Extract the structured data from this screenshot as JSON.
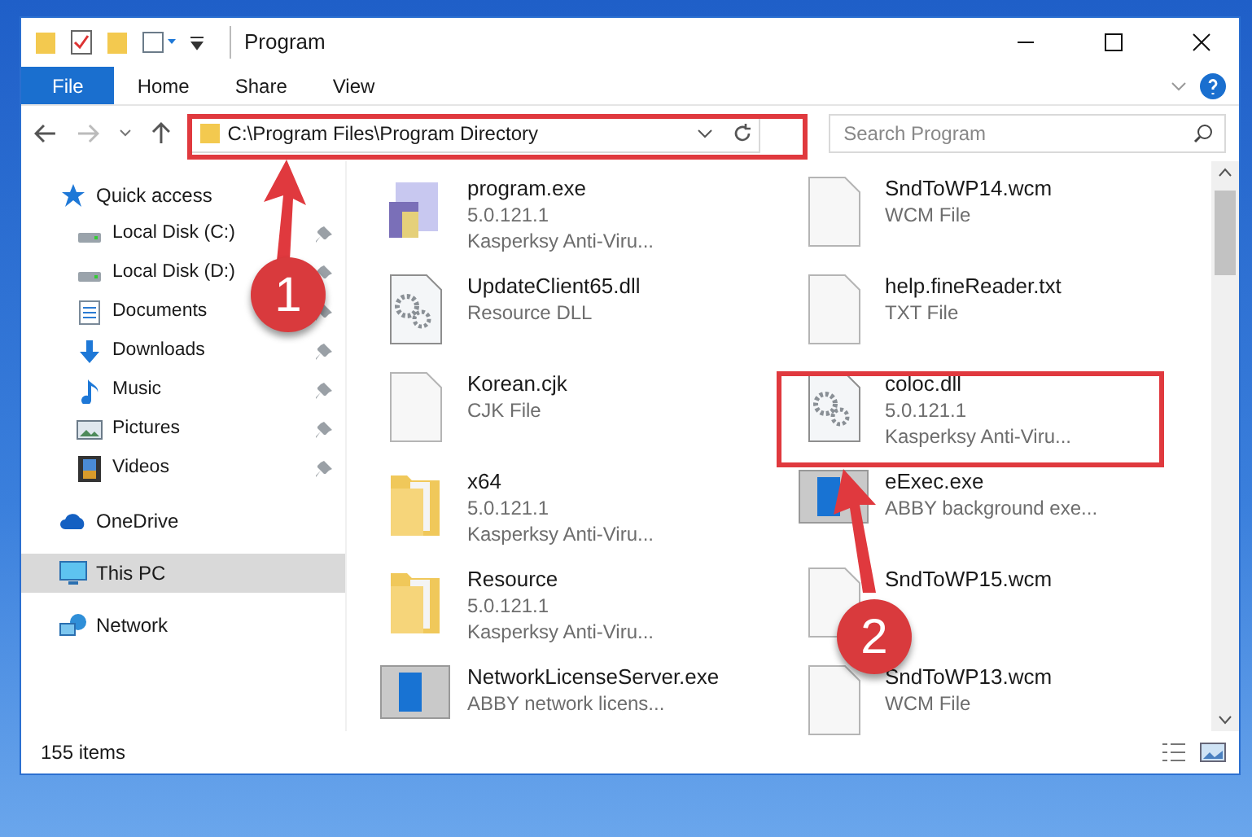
{
  "window": {
    "title": "Program"
  },
  "ribbon_tabs": [
    {
      "label": "File",
      "kind": "file"
    },
    {
      "label": "Home",
      "kind": "tab"
    },
    {
      "label": "Share",
      "kind": "tab"
    },
    {
      "label": "View",
      "kind": "tab"
    }
  ],
  "address": {
    "path": "C:\\Program Files\\Program Directory"
  },
  "search": {
    "placeholder": "Search Program"
  },
  "sidebar": {
    "items": [
      {
        "label": "Quick access",
        "selected": false,
        "children": [
          {
            "label": "Local Disk (C:)",
            "pinned": true,
            "selected": false
          },
          {
            "label": "Local Disk (D:)",
            "pinned": true,
            "selected": false
          },
          {
            "label": "Documents",
            "pinned": true,
            "selected": false
          },
          {
            "label": "Downloads",
            "pinned": true,
            "selected": false
          },
          {
            "label": "Music",
            "pinned": true,
            "selected": false
          },
          {
            "label": "Pictures",
            "pinned": true,
            "selected": false
          },
          {
            "label": "Videos",
            "pinned": true,
            "selected": false
          }
        ]
      },
      {
        "label": "OneDrive",
        "selected": false
      },
      {
        "label": "This PC",
        "selected": true
      },
      {
        "label": "Network",
        "selected": false
      }
    ]
  },
  "files": [
    {
      "name": "program.exe",
      "details": [
        "5.0.121.1",
        "Kasperksy Anti-Viru..."
      ],
      "kind": "installer"
    },
    {
      "name": "SndToWP14.wcm",
      "details": [
        "WCM File"
      ],
      "kind": "blank"
    },
    {
      "name": "UpdateClient65.dll",
      "details": [
        "Resource DLL"
      ],
      "kind": "gear"
    },
    {
      "name": "help.fineReader.txt",
      "details": [
        "TXT File"
      ],
      "kind": "blank"
    },
    {
      "name": "Korean.cjk",
      "details": [
        "CJK File"
      ],
      "kind": "blank"
    },
    {
      "name": "coloc.dll",
      "details": [
        "5.0.121.1",
        "Kasperksy Anti-Viru..."
      ],
      "kind": "gear"
    },
    {
      "name": "x64",
      "details": [
        "5.0.121.1",
        "Kasperksy Anti-Viru..."
      ],
      "kind": "folder"
    },
    {
      "name": "eExec.exe",
      "details": [
        "ABBY background exe..."
      ],
      "kind": "window"
    },
    {
      "name": "Resource",
      "details": [
        "5.0.121.1",
        "Kasperksy Anti-Viru..."
      ],
      "kind": "folder"
    },
    {
      "name": "SndToWP15.wcm",
      "kind": "blank"
    },
    {
      "name": "NetworkLicenseServer.exe",
      "details": [
        "ABBY network licens..."
      ],
      "kind": "window"
    },
    {
      "name": "SndToWP13.wcm",
      "details": [
        "WCM File"
      ],
      "kind": "blank"
    }
  ],
  "status_bar": {
    "count": "155 items"
  },
  "annotations": [
    {
      "number": "1"
    },
    {
      "number": "2"
    }
  ]
}
